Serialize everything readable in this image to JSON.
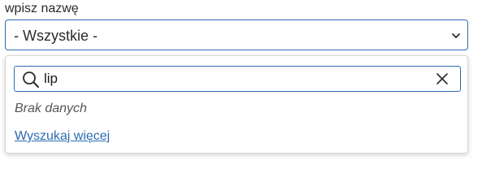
{
  "field": {
    "label": "wpisz nazwę",
    "selected_value": "- Wszystkie -"
  },
  "dropdown": {
    "search": {
      "value": "lip",
      "placeholder": ""
    },
    "empty_message": "Brak danych",
    "more_link": "Wyszukaj więcej"
  },
  "icons": {
    "chevron": "chevron-down-icon",
    "search": "search-icon",
    "clear": "close-icon"
  },
  "colors": {
    "accent": "#2b6cb0",
    "text": "#2b2b2b",
    "muted": "#555555"
  }
}
